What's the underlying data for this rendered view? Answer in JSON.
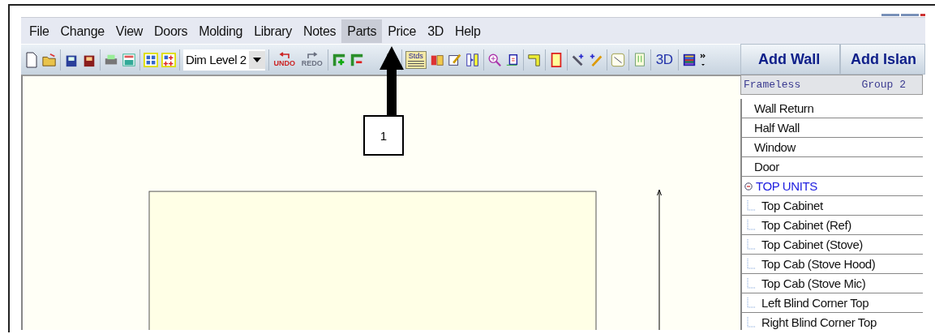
{
  "menu": [
    {
      "label": "File",
      "selected": false
    },
    {
      "label": "Change",
      "selected": false
    },
    {
      "label": "View",
      "selected": false
    },
    {
      "label": "Doors",
      "selected": false
    },
    {
      "label": "Molding",
      "selected": false
    },
    {
      "label": "Library",
      "selected": false
    },
    {
      "label": "Notes",
      "selected": false
    },
    {
      "label": "Parts",
      "selected": true
    },
    {
      "label": "Price",
      "selected": false
    },
    {
      "label": "3D",
      "selected": false
    },
    {
      "label": "Help",
      "selected": false
    }
  ],
  "toolbar": {
    "dim_level": "Dim Level 2",
    "undo": {
      "label": "UNDO",
      "disabled": false
    },
    "redo": {
      "label": "REDO",
      "disabled": true
    },
    "standards": "Stds",
    "view_3d": "3D"
  },
  "panel": {
    "buttons": [
      "Add Wall",
      "Add Islan"
    ],
    "header": {
      "style": "Frameless",
      "group": "Group 2"
    },
    "items": [
      {
        "label": "Wall Return"
      },
      {
        "label": "Half Wall"
      },
      {
        "label": "Window"
      },
      {
        "label": "Door"
      },
      {
        "label": "TOP UNITS",
        "expanded": true,
        "children": [
          {
            "label": "Top Cabinet"
          },
          {
            "label": "Top Cabinet (Ref)"
          },
          {
            "label": "Top Cabinet (Stove)"
          },
          {
            "label": "Top Cab (Stove Hood)"
          },
          {
            "label": "Top Cab (Stove Mic)"
          },
          {
            "label": "Left Blind Corner Top"
          },
          {
            "label": "Right Blind Corner Top"
          }
        ]
      }
    ]
  },
  "callout": {
    "number": "1"
  }
}
